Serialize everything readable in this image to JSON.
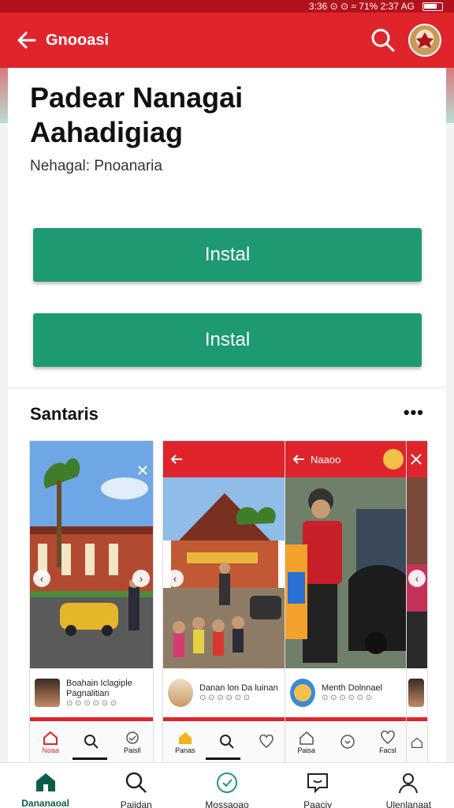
{
  "status_bar": {
    "text": "3:36 ⊙ ⊙  ≈  71%  2:37 AG"
  },
  "app_bar": {
    "title": "Gnooasi"
  },
  "hero": {
    "title_line1": "Padear Nanagai",
    "title_line2": "Aahadigiag",
    "subtitle": "Nehagal: Pnoanaria"
  },
  "buttons": {
    "install_1": "Instal",
    "install_2": "Instal"
  },
  "screenshots_section": {
    "title": "Santaris",
    "more_label": "•••",
    "cards": [
      {
        "header": "",
        "caption_title": "Boahain Iclagiple Pagnalitian",
        "caption_meta": "⊙ ⊙ ⊙ ⊙ ⊙ ⊙",
        "nav": [
          "Noaa",
          "",
          "Paisll"
        ]
      },
      {
        "header": "",
        "caption_title": "Danan lon Da luinan",
        "caption_meta": "⊙ ⊙ ⊙ ⊙ ⊙ ⊙",
        "nav": [
          "Panas",
          "",
          ""
        ]
      },
      {
        "header": "Naaoo",
        "caption_title": "Menth Dolnnael",
        "caption_meta": "⊙ ⊙ ⊙ ⊙ ⊙ ⊙",
        "nav": [
          "Paisa",
          "",
          "Facsl"
        ]
      },
      {
        "header": "",
        "caption_title": "",
        "caption_meta": "",
        "nav": [
          "",
          "",
          ""
        ]
      }
    ]
  },
  "bottom_nav": [
    {
      "label": "Dananaoal",
      "icon": "home-icon"
    },
    {
      "label": "Pajidan",
      "icon": "search-icon"
    },
    {
      "label": "Mossaoao",
      "icon": "heart-check-icon"
    },
    {
      "label": "Paaciy",
      "icon": "chat-icon"
    },
    {
      "label": "Ulenlanaat",
      "icon": "person-icon"
    }
  ],
  "colors": {
    "brand_red": "#e0242c",
    "install_green": "#1e9a73",
    "active_nav": "#0b5d4a"
  }
}
